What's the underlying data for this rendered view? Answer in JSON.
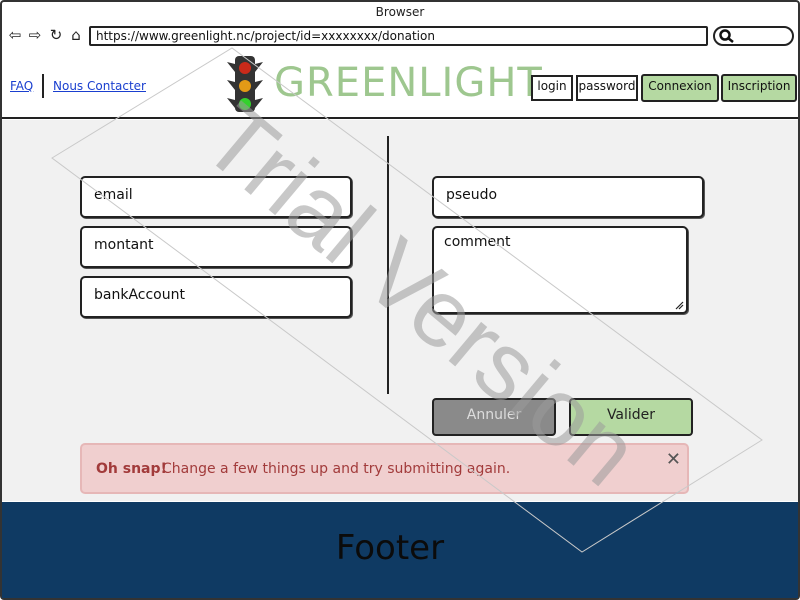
{
  "browser": {
    "title": "Browser",
    "url": "https://www.greenlight.nc/project/id=xxxxxxxx/donation"
  },
  "header": {
    "faq_link": "FAQ",
    "contact_link": "Nous Contacter",
    "brand": "GREENLIGHT",
    "login_field": "login",
    "password_field": "password",
    "connexion_button": "Connexion",
    "inscription_button": "Inscription"
  },
  "form": {
    "email": "email",
    "montant": "montant",
    "bank_account": "bankAccount",
    "pseudo": "pseudo",
    "comment": "comment",
    "cancel_button": "Annuler",
    "submit_button": "Valider"
  },
  "alert": {
    "strong": "Oh snap!",
    "message": "Change a few things up and try submitting again.",
    "close": "✕"
  },
  "footer": {
    "text": "Footer"
  },
  "watermark": "Trial Version",
  "colors": {
    "brand": "#9ec78f",
    "button_green": "#b5d9a2",
    "footer": "#0f3a63",
    "alert_bg": "#f0cfcf",
    "alert_text": "#a23b3b",
    "content_bg": "#f1f1f1"
  },
  "icons": [
    "back-icon",
    "forward-icon",
    "reload-icon",
    "home-icon",
    "search-icon",
    "traffic-light-logo",
    "close-icon",
    "resize-grip-icon"
  ]
}
